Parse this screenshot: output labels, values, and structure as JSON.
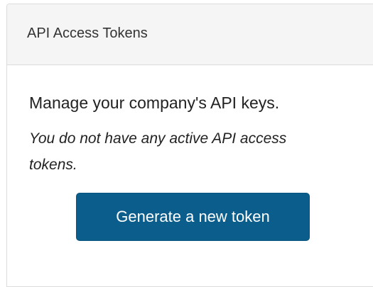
{
  "panel": {
    "title": "API Access Tokens",
    "intro": "Manage your company's API keys.",
    "empty_message": "You do not have any active API access tokens.",
    "generate_button_label": "Generate a new token"
  },
  "colors": {
    "button_background": "#0b5e8c",
    "header_background": "#f5f5f5",
    "border": "#dcdcdc"
  }
}
